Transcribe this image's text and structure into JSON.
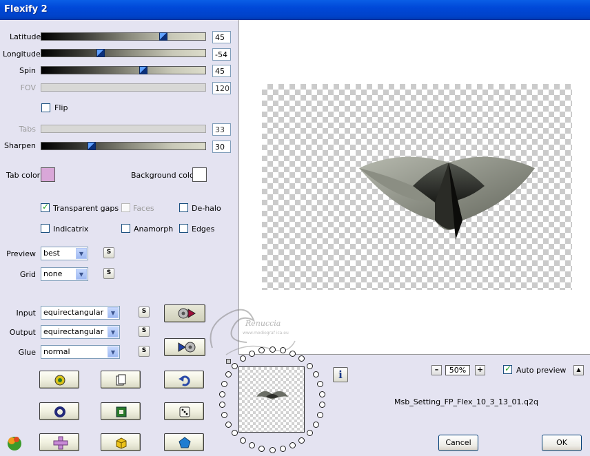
{
  "window": {
    "title": "Flexify 2"
  },
  "sliders": [
    {
      "label": "Latitude",
      "value": "45",
      "enabled": true
    },
    {
      "label": "Longitude",
      "value": "-54",
      "enabled": true
    },
    {
      "label": "Spin",
      "value": "45",
      "enabled": true
    },
    {
      "label": "FOV",
      "value": "120",
      "enabled": false
    },
    {
      "label": "Tabs",
      "value": "33",
      "enabled": false
    },
    {
      "label": "Sharpen",
      "value": "30",
      "enabled": true
    }
  ],
  "flip": {
    "label": "Flip",
    "checked": false
  },
  "colors": {
    "tab_color_label": "Tab color",
    "tab_color": "#d9a7d8",
    "background_color_label": "Background color",
    "background_color": "#ffffff"
  },
  "options": {
    "transparent_gaps": "Transparent gaps",
    "faces": "Faces",
    "de_halo": "De-halo",
    "indicatrix": "Indicatrix",
    "anamorph": "Anamorph",
    "edges": "Edges"
  },
  "dropdowns": {
    "preview": {
      "label": "Preview",
      "value": "best"
    },
    "grid": {
      "label": "Grid",
      "value": "none"
    },
    "input": {
      "label": "Input",
      "value": "equirectangular"
    },
    "output": {
      "label": "Output",
      "value": "equirectangular"
    },
    "glue": {
      "label": "Glue",
      "value": "normal"
    }
  },
  "small_button_label": "S",
  "zoom": {
    "value": "50%",
    "minus": "–",
    "plus": "+"
  },
  "auto_preview": {
    "label": "Auto preview",
    "checked": true
  },
  "collapse_button": "▲",
  "info_icon": "i",
  "filename": "Msb_Setting_FP_Flex_10_3_13_01.q2q",
  "buttons": {
    "cancel": "Cancel",
    "ok": "OK"
  },
  "watermark": {
    "line1": "Renuccia",
    "line2": "www.modiograf ica.eu"
  },
  "icons": [
    "randomize-icon",
    "copy-icon",
    "undo-icon",
    "ring-icon",
    "frame-icon",
    "dice-icon",
    "flower-icon",
    "plus-shape-icon",
    "cube-icon",
    "pentagon-icon",
    "camera-play-icon",
    "play-camera-icon"
  ]
}
